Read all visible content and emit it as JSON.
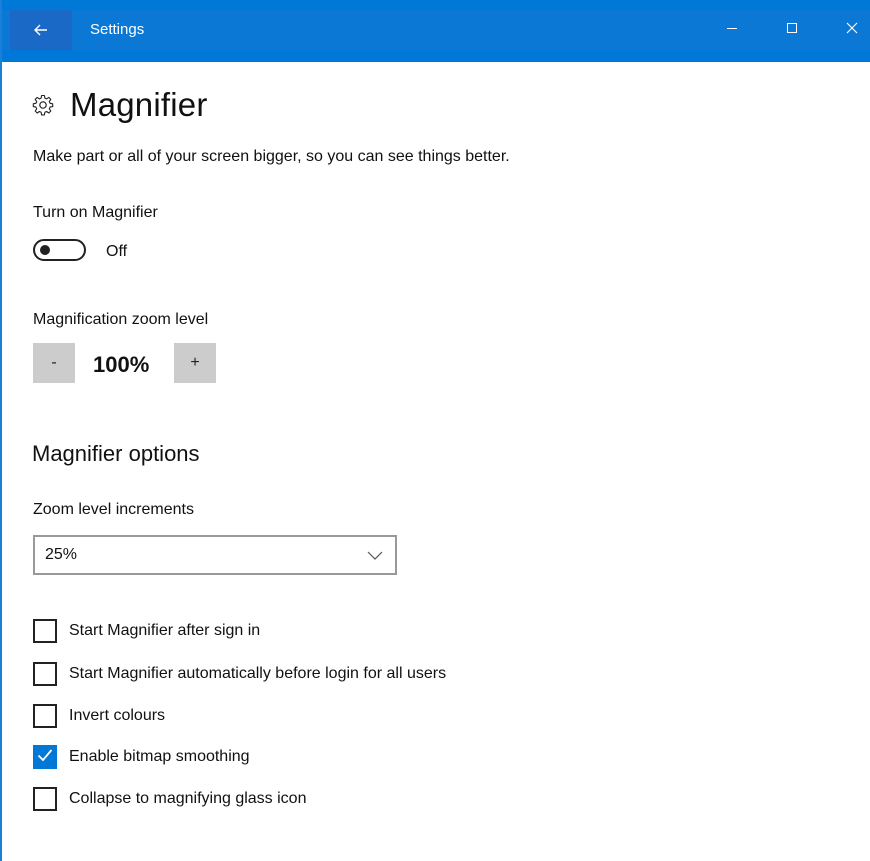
{
  "window": {
    "title": "Settings",
    "accent_color": "#0078d7"
  },
  "page": {
    "title": "Magnifier",
    "description": "Make part or all of your screen bigger, so you can see things better."
  },
  "magnifier_toggle": {
    "label": "Turn on Magnifier",
    "state_text": "Off",
    "on": false
  },
  "zoom": {
    "label": "Magnification zoom level",
    "decrease_label": "-",
    "value": "100%",
    "increase_label": "+"
  },
  "options": {
    "section_title": "Magnifier options",
    "increments_label": "Zoom level increments",
    "increments_value": "25%",
    "checkboxes": [
      {
        "label": "Start Magnifier after sign in",
        "checked": false
      },
      {
        "label": "Start Magnifier automatically before login for all users",
        "checked": false
      },
      {
        "label": "Invert colours",
        "checked": false
      },
      {
        "label": "Enable bitmap smoothing",
        "checked": true
      },
      {
        "label": "Collapse to magnifying glass icon",
        "checked": false
      }
    ]
  },
  "icons": {
    "back": "arrow-left",
    "minimize": "minimize",
    "maximize": "maximize",
    "close": "close",
    "page": "gear",
    "dropdown": "chevron-down",
    "check": "checkmark"
  }
}
